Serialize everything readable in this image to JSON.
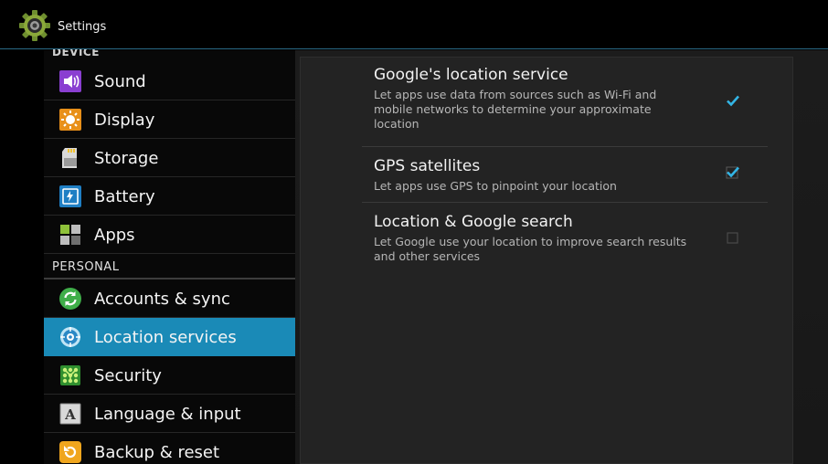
{
  "titlebar": {
    "title": "Settings",
    "icon": "settings-gear-icon"
  },
  "sidebar": {
    "section_device_label": "DEVICE",
    "section_personal_label": "PERSONAL",
    "items": [
      {
        "label": "Sound",
        "icon": "speaker-icon",
        "active": false
      },
      {
        "label": "Display",
        "icon": "brightness-icon",
        "active": false
      },
      {
        "label": "Storage",
        "icon": "sd-card-icon",
        "active": false
      },
      {
        "label": "Battery",
        "icon": "battery-icon",
        "active": false
      },
      {
        "label": "Apps",
        "icon": "apps-grid-icon",
        "active": false
      },
      {
        "label": "Accounts & sync",
        "icon": "sync-icon",
        "active": false
      },
      {
        "label": "Location services",
        "icon": "location-target-icon",
        "active": true
      },
      {
        "label": "Security",
        "icon": "lock-grid-icon",
        "active": false
      },
      {
        "label": "Language & input",
        "icon": "keyboard-a-icon",
        "active": false
      },
      {
        "label": "Backup & reset",
        "icon": "backup-icon",
        "active": false
      }
    ]
  },
  "location": {
    "prefs": [
      {
        "title": "Google's location service",
        "summary": "Let apps use data from sources such as Wi-Fi and mobile networks to determine your approximate location",
        "checked": true
      },
      {
        "title": "GPS satellites",
        "summary": "Let apps use GPS to pinpoint your location",
        "checked": true
      },
      {
        "title": "Location & Google search",
        "summary": "Let Google use your location to improve search results and other services",
        "checked": false
      }
    ]
  },
  "colors": {
    "accent": "#1a8ab7",
    "check": "#33b5e5"
  }
}
